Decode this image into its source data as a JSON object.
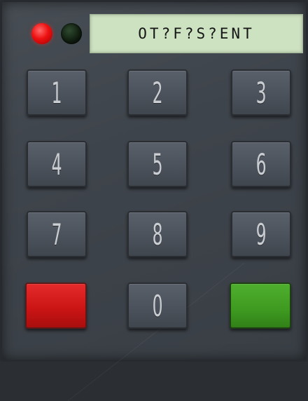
{
  "indicators": {
    "red_led": "on",
    "green_led": "off"
  },
  "display": {
    "text": "OT?F?S?ENT"
  },
  "keys": [
    "1",
    "2",
    "3",
    "4",
    "5",
    "6",
    "7",
    "8",
    "9",
    "0"
  ],
  "colors": {
    "panel": "#3e444b",
    "display_bg": "#cde2c1",
    "key": "#4b525b",
    "cancel_key": "#d01818",
    "confirm_key": "#44a024"
  }
}
